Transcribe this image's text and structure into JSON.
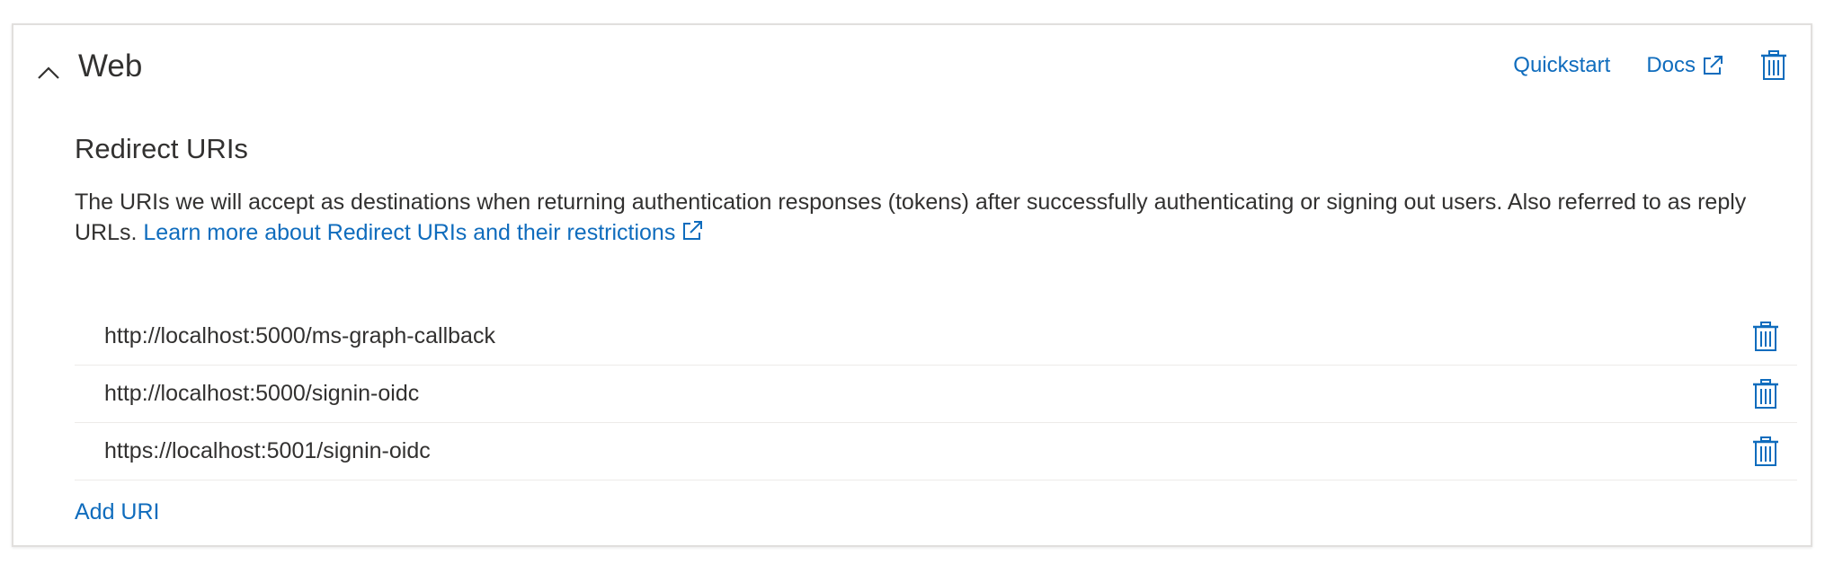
{
  "platform": {
    "title": "Web",
    "quickstart_label": "Quickstart",
    "docs_label": "Docs"
  },
  "redirect": {
    "title": "Redirect URIs",
    "description": "The URIs we will accept as destinations when returning authentication responses (tokens) after successfully authenticating or signing out users. Also referred to as reply URLs. ",
    "learn_more_label": "Learn more about Redirect URIs and their restrictions",
    "uris": [
      "http://localhost:5000/ms-graph-callback",
      "http://localhost:5000/signin-oidc",
      "https://localhost:5001/signin-oidc"
    ],
    "add_uri_label": "Add URI"
  },
  "icons": {
    "collapse": "chevron-up-icon",
    "external": "external-link-icon",
    "delete": "trash-icon"
  },
  "colors": {
    "link": "#0f6cbd",
    "text": "#323130",
    "border": "#e1dfdd",
    "divider": "#edebe9"
  }
}
